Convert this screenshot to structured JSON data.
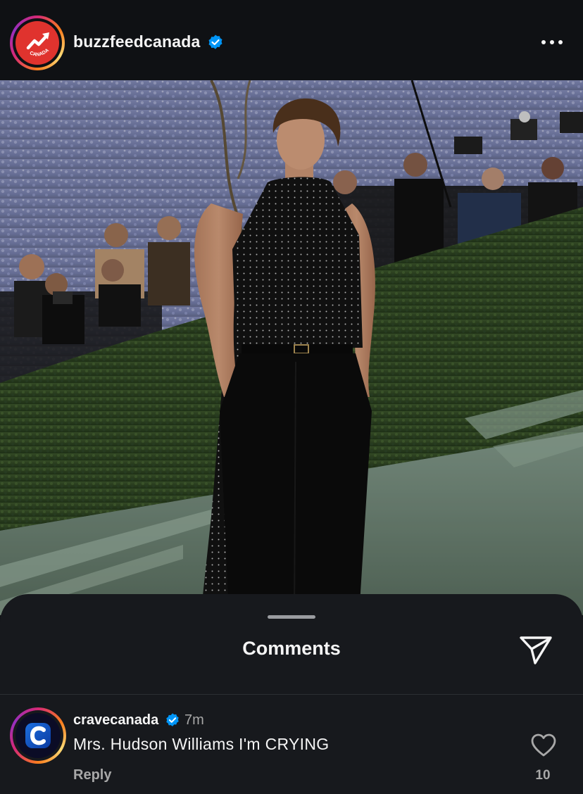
{
  "post": {
    "username": "buzzfeedcanada",
    "avatar_badge_text": "CANADA",
    "verified_icon": "verified-badge-icon",
    "more_icon": "more-options-icon",
    "photo_description_icon": "post-photo"
  },
  "comments_sheet": {
    "title": "Comments",
    "share_icon": "send-icon"
  },
  "comments": [
    {
      "username": "cravecanada",
      "time": "7m",
      "text": "Mrs. Hudson Williams I'm CRYING",
      "reply_label": "Reply",
      "likes": "10"
    }
  ],
  "colors": {
    "background": "#0f1114",
    "sheet": "#17191d",
    "verified": "#0095f6",
    "muted_text": "#a8a8a8",
    "buzzfeed_red": "#e0332e"
  }
}
